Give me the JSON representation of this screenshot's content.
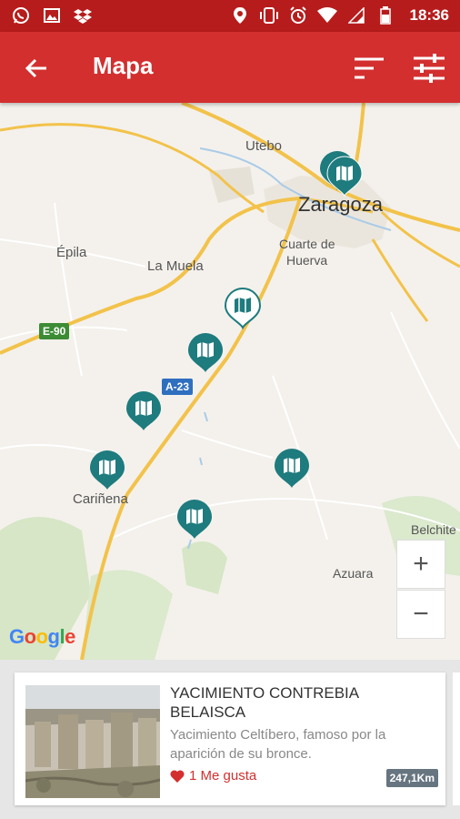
{
  "status_bar": {
    "time": "18:36",
    "left_icons": [
      "whatsapp-icon",
      "image-icon",
      "dropbox-icon"
    ],
    "right_icons": [
      "location-icon",
      "vibrate-icon",
      "alarm-icon",
      "wifi-icon",
      "signal-icon",
      "battery-icon"
    ]
  },
  "app_bar": {
    "title": "Mapa",
    "back_icon": "arrow-back-icon",
    "actions": [
      "sort-icon",
      "filter-sliders-icon"
    ],
    "color": "#d32f2f"
  },
  "map": {
    "places": {
      "utebo": "Utebo",
      "zaragoza": "Zaragoza",
      "cuarte1": "Cuarte de",
      "cuarte2": "Huerva",
      "epila": "Épila",
      "la_muela": "La Muela",
      "carinena": "Cariñena",
      "belchite": "Belchite",
      "azuara": "Azuara"
    },
    "road_shields": {
      "e90": "E-90",
      "a23": "A-23"
    },
    "marker_color": "#1e7b7e",
    "zoom_in": "+",
    "zoom_out": "−",
    "attribution": [
      "G",
      "o",
      "o",
      "g",
      "l",
      "e"
    ]
  },
  "card": {
    "title": "YACIMIENTO CONTREBIA BELAISCA",
    "description": "Yacimiento Celtíbero, famoso por la aparición de su bronce.",
    "likes": "1 Me gusta",
    "distance": "247,1Km",
    "like_color": "#d32f2f"
  }
}
